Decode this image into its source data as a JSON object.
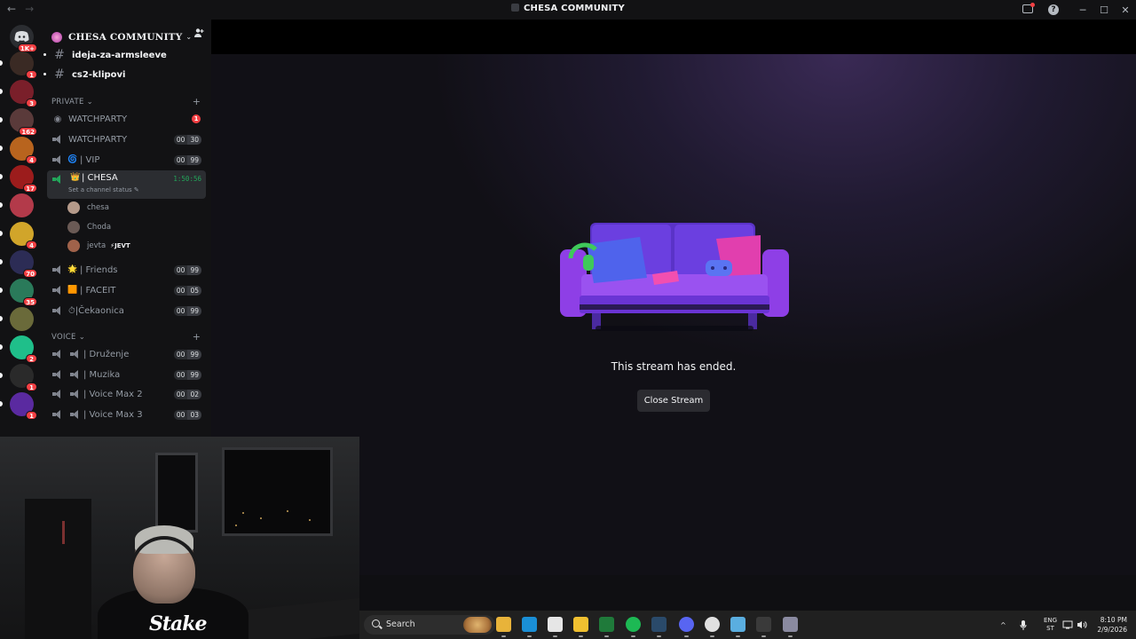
{
  "window": {
    "title": "CHESA COMMUNITY",
    "back_glyph": "←",
    "forward_glyph": "→",
    "minimize_glyph": "─",
    "maximize_glyph": "☐",
    "close_glyph": "✕",
    "help_glyph": "?"
  },
  "server_rail": {
    "home_badge": "1K+",
    "servers": [
      {
        "name": "server-1",
        "badge": "1",
        "color": "#3a2a24"
      },
      {
        "name": "server-2",
        "badge": "3",
        "color": "#7a1f2a"
      },
      {
        "name": "server-3",
        "badge": "162",
        "color": "#5a3a3a"
      },
      {
        "name": "server-4",
        "badge": "4",
        "color": "#b8641e"
      },
      {
        "name": "server-5",
        "badge": "17",
        "color": "#9c1c1c"
      },
      {
        "name": "server-6",
        "badge": "",
        "color": "#b33a4a"
      },
      {
        "name": "server-7",
        "badge": "4",
        "color": "#d1a52a"
      },
      {
        "name": "server-8",
        "badge": "70",
        "color": "#2c2c55"
      },
      {
        "name": "server-9",
        "badge": "35",
        "color": "#2a7a5a"
      },
      {
        "name": "server-10",
        "badge": "",
        "color": "#6a6a3a"
      },
      {
        "name": "server-11",
        "badge": "2",
        "color": "#1fbf8a"
      },
      {
        "name": "server-12",
        "badge": "1",
        "color": "#2a2a2a"
      },
      {
        "name": "server-13",
        "badge": "1",
        "color": "#5a2aa0"
      }
    ]
  },
  "sidebar": {
    "server_name": "CHESA COMMUNITY",
    "text_channels": [
      "ideja-za-armsleeve",
      "cs2-klipovi"
    ],
    "categories": {
      "private": "PRIVATE",
      "voice": "VOICE"
    },
    "private_channels": [
      {
        "name": "WATCHPARTY",
        "kind": "stage",
        "badge": "1"
      },
      {
        "name": "WATCHPARTY",
        "kind": "voice",
        "count": "00",
        "limit": "30"
      },
      {
        "name": "| VIP",
        "kind": "voice",
        "emoji": "🌀",
        "count": "00",
        "limit": "99"
      }
    ],
    "active_channel": {
      "name": "| CHESA",
      "emoji": "👑",
      "timer": "1:50:56",
      "status": "Set a channel status"
    },
    "members": [
      {
        "name": "chesa",
        "tag": "",
        "avatar_color": "#b59a8a"
      },
      {
        "name": "Choda",
        "tag": "",
        "avatar_color": "#6a5a55"
      },
      {
        "name": "jevta",
        "tag": "⚡JEVT",
        "avatar_color": "#a0624a"
      }
    ],
    "more_private": [
      {
        "name": "| Friends",
        "emoji": "🌟",
        "count": "00",
        "limit": "99"
      },
      {
        "name": "| FACEIT",
        "emoji": "🟧",
        "count": "00",
        "limit": "05"
      },
      {
        "name": "⏱|Čekaonica",
        "emoji": "",
        "count": "00",
        "limit": "99"
      }
    ],
    "voice_channels": [
      {
        "name": "| Druženje",
        "count": "00",
        "limit": "99"
      },
      {
        "name": "| Muzika",
        "count": "00",
        "limit": "99"
      },
      {
        "name": "| Voice Max 2",
        "count": "00",
        "limit": "02"
      },
      {
        "name": "| Voice Max 3",
        "count": "00",
        "limit": "03"
      }
    ]
  },
  "stream": {
    "ended_message": "This stream has ended.",
    "close_label": "Close Stream"
  },
  "webcam": {
    "brand": "Stake"
  },
  "taskbar": {
    "search_placeholder": "Search",
    "lang_top": "ENG",
    "lang_bottom": "ST",
    "time": "8:10 PM",
    "date": "2/9/2026",
    "apps": [
      {
        "name": "file-explorer-icon",
        "color": "#e8b33a"
      },
      {
        "name": "edge-icon",
        "color": "#1a8fd6"
      },
      {
        "name": "store-icon",
        "color": "#e6e6e6"
      },
      {
        "name": "winamp-icon",
        "color": "#f0c030"
      },
      {
        "name": "excel-icon",
        "color": "#1f7a3a"
      },
      {
        "name": "spotify-icon",
        "color": "#1db954"
      },
      {
        "name": "steam-icon",
        "color": "#2a4a6a"
      },
      {
        "name": "discord-icon",
        "color": "#5865f2"
      },
      {
        "name": "chrome-icon",
        "color": "#e0e0e0"
      },
      {
        "name": "notepad-icon",
        "color": "#5aaee0"
      },
      {
        "name": "app-icon",
        "color": "#3a3a3a"
      },
      {
        "name": "settings-icon",
        "color": "#8a8aa0"
      }
    ]
  }
}
